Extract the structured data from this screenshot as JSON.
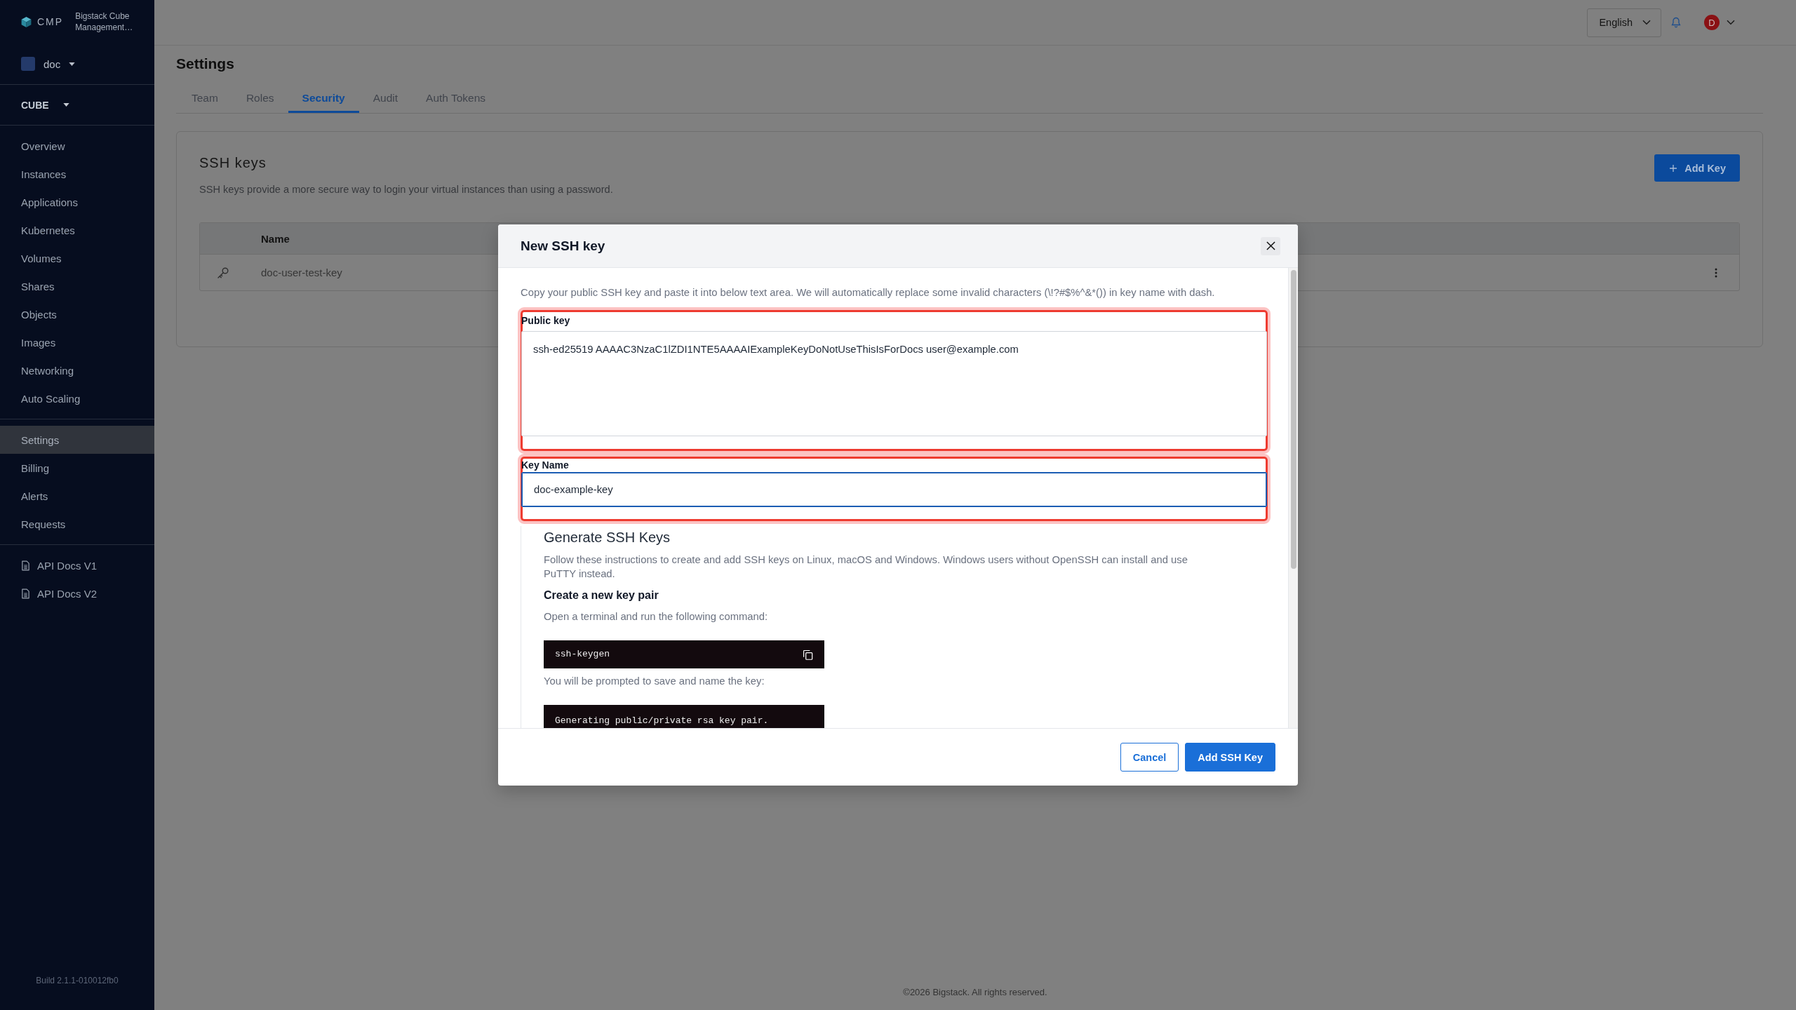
{
  "sidebar": {
    "brand": {
      "name": "CMP",
      "product": "Bigstack Cube Management…"
    },
    "project": "doc",
    "region": "CUBE",
    "groups": [
      {
        "kind": "nav",
        "items": [
          {
            "label": "Overview",
            "selected": false
          },
          {
            "label": "Instances",
            "selected": false
          },
          {
            "label": "Applications",
            "selected": false
          },
          {
            "label": "Kubernetes",
            "selected": false
          },
          {
            "label": "Volumes",
            "selected": false
          },
          {
            "label": "Shares",
            "selected": false
          },
          {
            "label": "Objects",
            "selected": false
          },
          {
            "label": "Images",
            "selected": false
          },
          {
            "label": "Networking",
            "selected": false
          },
          {
            "label": "Auto Scaling",
            "selected": false
          }
        ]
      },
      {
        "kind": "nav",
        "items": [
          {
            "label": "Settings",
            "selected": true
          },
          {
            "label": "Billing",
            "selected": false
          },
          {
            "label": "Alerts",
            "selected": false
          },
          {
            "label": "Requests",
            "selected": false
          }
        ]
      },
      {
        "kind": "docs",
        "items": [
          {
            "label": "API Docs V1",
            "selected": false
          },
          {
            "label": "API Docs V2",
            "selected": false
          }
        ]
      }
    ],
    "build": "Build 2.1.1-010012fb0"
  },
  "header": {
    "language": "English",
    "avatar": "D"
  },
  "page": {
    "title": "Settings",
    "tabs": [
      {
        "label": "Team",
        "selected": false
      },
      {
        "label": "Roles",
        "selected": false
      },
      {
        "label": "Security",
        "selected": true
      },
      {
        "label": "Audit",
        "selected": false
      },
      {
        "label": "Auth Tokens",
        "selected": false
      }
    ],
    "card": {
      "title": "SSH keys",
      "description": "SSH keys provide a more secure way to login your virtual instances than using a password.",
      "add_button": "Add Key",
      "table": {
        "columns": [
          "Name"
        ],
        "rows": [
          {
            "name": "doc-user-test-key"
          }
        ]
      }
    }
  },
  "dialog": {
    "title": "New SSH key",
    "description": "Copy your public SSH key and paste it into below text area. We will automatically replace some invalid characters (\\!?#$%^&*()) in key name with dash.",
    "fields": [
      {
        "kind": "textarea",
        "label": "Public key",
        "value": "ssh-ed25519 AAAAC3NzaC1lZDI1NTE5AAAAIExampleKeyDoNotUseThisIsForDocs user@example.com",
        "focused": false,
        "highlighted": true
      },
      {
        "kind": "input",
        "label": "Key Name",
        "value": "doc-example-key",
        "focused": true,
        "highlighted": true
      }
    ],
    "guide": {
      "title": "Generate SSH Keys",
      "intro": "Follow these instructions to create and add SSH keys on Linux, macOS and Windows. Windows users without OpenSSH can install and use PuTTY instead.",
      "steps": [
        {
          "kind": "heading",
          "text": "Create a new key pair"
        },
        {
          "kind": "text",
          "text": "Open a terminal and run the following command:"
        },
        {
          "kind": "code",
          "text": "ssh-keygen",
          "copyable": true
        },
        {
          "kind": "text",
          "text": "You will be prompted to save and name the key:"
        },
        {
          "kind": "code",
          "text": "Generating public/private rsa key pair.",
          "copyable": false
        }
      ]
    },
    "buttons": [
      {
        "kind": "secondary",
        "label": "Cancel"
      },
      {
        "kind": "primary",
        "label": "Add SSH Key"
      }
    ]
  },
  "footer": "©2026 Bigstack. All rights reserved."
}
